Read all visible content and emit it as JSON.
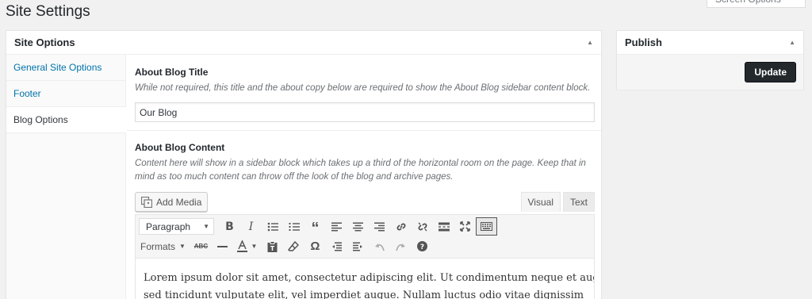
{
  "page": {
    "title": "Site Settings",
    "screen_options": "Screen Options"
  },
  "main_box": {
    "title": "Site Options",
    "nav": [
      {
        "label": "General Site Options",
        "active": false
      },
      {
        "label": "Footer",
        "active": false
      },
      {
        "label": "Blog Options",
        "active": true
      }
    ],
    "about_title": {
      "label": "About Blog Title",
      "description": "While not required, this title and the about copy below are required to show the About Blog sidebar content block.",
      "value": "Our Blog"
    },
    "about_content": {
      "label": "About Blog Content",
      "description": "Content here will show in a sidebar block which takes up a third of the horizontal room on the page. Keep that in mind as too much content can throw off the look of the blog and archive pages.",
      "add_media": "Add Media",
      "tabs": [
        "Visual",
        "Text"
      ],
      "paragraph_select": "Paragraph",
      "formats": "Formats",
      "body_line1": "Lorem ipsum dolor sit amet, consectetur adipiscing elit. Ut condimentum neque et augue",
      "body_line2": "sed tincidunt vulputate elit, vel imperdiet augue. Nullam luctus odio vitae dignissim"
    }
  },
  "publish": {
    "title": "Publish",
    "update_label": "Update"
  },
  "colors": {
    "link": "#0073aa",
    "update_button": "#23282d"
  }
}
